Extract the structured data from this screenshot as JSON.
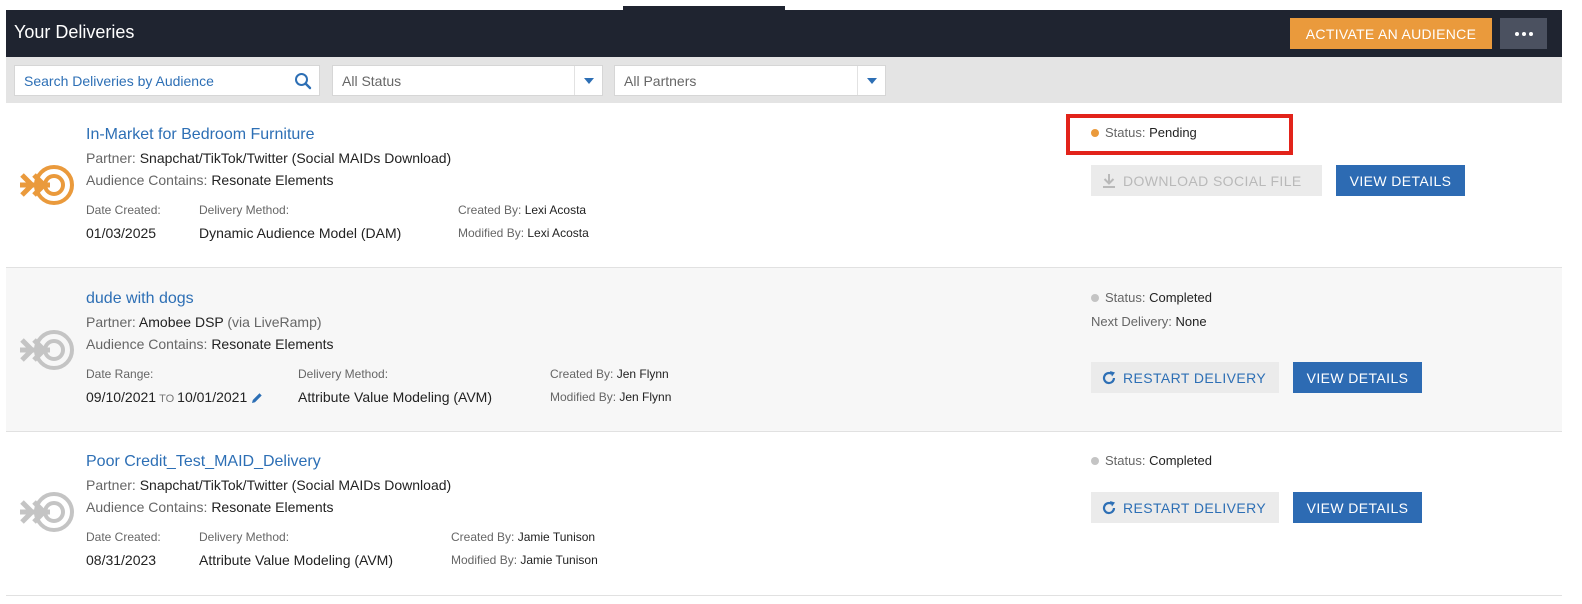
{
  "header": {
    "title": "Your Deliveries",
    "activate_label": "ACTIVATE AN AUDIENCE",
    "more_icon": "more-horizontal-icon"
  },
  "filters": {
    "search_placeholder": "Search Deliveries by Audience",
    "status_selected": "All Status",
    "partners_selected": "All Partners"
  },
  "labels": {
    "partner": "Partner: ",
    "audience_contains": "Audience Contains: ",
    "date_created": "Date Created:",
    "date_range": "Date Range:",
    "delivery_method": "Delivery Method:",
    "created_by": "Created By: ",
    "modified_by": "Modified By: ",
    "status": "Status: ",
    "next_delivery": "Next Delivery: ",
    "to": "TO",
    "download_social_file": "DOWNLOAD SOCIAL FILE",
    "restart_delivery": "RESTART DELIVERY",
    "view_details": "VIEW DETAILS"
  },
  "colors": {
    "accent_orange": "#ea9a3c",
    "link_blue": "#2d6fb5",
    "status_pending": "#ea9a3c",
    "status_completed": "#c4c4c4",
    "highlight_red": "#e2231a"
  },
  "deliveries": [
    {
      "title": "In-Market for Bedroom Furniture",
      "partner": "Snapchat/TikTok/Twitter (Social MAIDs Download)",
      "audience_contains": "Resonate Elements",
      "date_created": "01/03/2025",
      "delivery_method": "Dynamic Audience Model (DAM)",
      "created_by": "Lexi Acosta",
      "modified_by": "Lexi Acosta",
      "status": "Pending",
      "icon_color": "#ea9a3c"
    },
    {
      "title": "dude with dogs",
      "partner": "Amobee DSP",
      "partner_suffix": " (via LiveRamp)",
      "audience_contains": "Resonate Elements",
      "date_range_start": "09/10/2021",
      "date_range_end": "10/01/2021",
      "delivery_method": "Attribute Value Modeling (AVM)",
      "created_by": "Jen Flynn",
      "modified_by": "Jen Flynn",
      "status": "Completed",
      "next_delivery": "None",
      "icon_color": "#c4c4c4"
    },
    {
      "title": "Poor Credit_Test_MAID_Delivery",
      "partner": "Snapchat/TikTok/Twitter (Social MAIDs Download)",
      "audience_contains": "Resonate Elements",
      "date_created": "08/31/2023",
      "delivery_method": "Attribute Value Modeling (AVM)",
      "created_by": "Jamie Tunison",
      "modified_by": "Jamie Tunison",
      "status": "Completed",
      "icon_color": "#c4c4c4"
    }
  ]
}
